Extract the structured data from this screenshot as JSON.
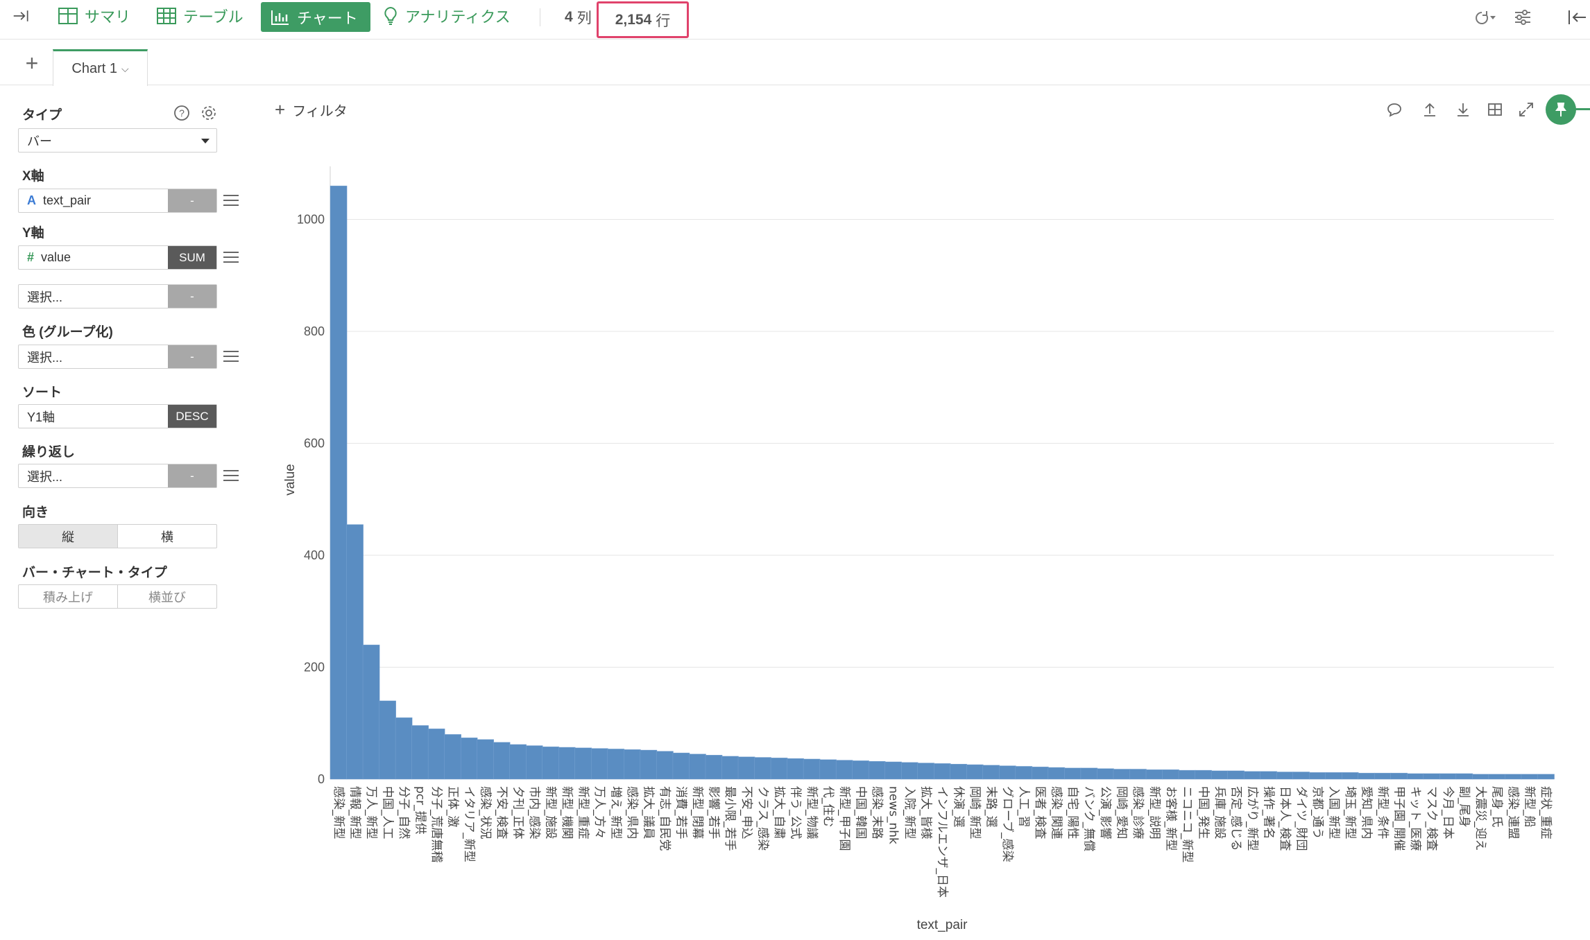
{
  "toolbar": {
    "summary_label": "サマリ",
    "table_label": "テーブル",
    "chart_label": "チャート",
    "analytics_label": "アナリティクス",
    "columns_count": "4",
    "columns_unit": "列",
    "rows_count": "2,154",
    "rows_unit": "行"
  },
  "tabs": {
    "add_label": "+",
    "active_tab": "Chart 1"
  },
  "panel": {
    "type_label": "タイプ",
    "type_value": "バー",
    "x_label": "X軸",
    "x_field": "text_pair",
    "x_field_type_icon": "A",
    "x_agg": "-",
    "y_label": "Y軸",
    "y_field": "value",
    "y_field_type_icon": "#",
    "y_agg": "SUM",
    "y2_placeholder": "選択...",
    "y2_agg": "-",
    "color_label": "色 (グループ化)",
    "color_placeholder": "選択...",
    "color_agg": "-",
    "sort_label": "ソート",
    "sort_field": "Y1軸",
    "sort_order": "DESC",
    "repeat_label": "繰り返し",
    "repeat_placeholder": "選択...",
    "repeat_agg": "-",
    "orientation_label": "向き",
    "orientation_vertical": "縦",
    "orientation_horizontal": "横",
    "bar_type_label": "バー・チャート・タイプ",
    "bar_type_stacked": "積み上げ",
    "bar_type_side": "横並び"
  },
  "chart_area": {
    "filter_label": "フィルタ"
  },
  "colors": {
    "accent": "#3e9c64",
    "bar": "#5a8dc2",
    "highlight": "#e0426b"
  },
  "chart_data": {
    "type": "bar",
    "xlabel": "text_pair",
    "ylabel": "value",
    "ylim": [
      0,
      1070
    ],
    "yticks": [
      0,
      200,
      400,
      600,
      800,
      1000
    ],
    "grid": true,
    "categories": [
      "感染_新型",
      "情報_新型",
      "万人_新型",
      "中国_人工",
      "分子_自然",
      "pcr_提供",
      "分子_荒唐無稽",
      "正体_激",
      "イタリア_新型",
      "感染_状況",
      "不安_検査",
      "夕刊_正体",
      "市内_感染",
      "新型_施設",
      "新型_機関",
      "新型_重症",
      "万人_方々",
      "増え_新型",
      "感染_県内",
      "拡大_議員",
      "有志_自民党",
      "消費_若手",
      "新型_閉幕",
      "影響_若手",
      "最小限_若手",
      "不安_申込",
      "クラス_感染",
      "拡大_自粛",
      "伴う_公式",
      "新型_物議",
      "代_住む",
      "新型_甲子園",
      "中国_韓国",
      "感染_末路",
      "news_nhk",
      "入院_新型",
      "拡大_皆様",
      "インフルエンザ_日本",
      "休演_選",
      "岡崎_新型",
      "末路_選",
      "グローブ_感染",
      "人工_習",
      "医者_検査",
      "感染_関連",
      "自宅_陽性",
      "バンク_無償",
      "公演_影響",
      "岡崎_愛知",
      "感染_診療",
      "新型_説明",
      "お客様_新型",
      "ニコニコ_新型",
      "中国_発生",
      "兵庫_施設",
      "否定_感じる",
      "広がり_新型",
      "操作_著名",
      "日本人_検査",
      "ダイツ_財団",
      "京都_通う",
      "入国_新型",
      "埼玉_新型",
      "愛知_県内",
      "新型_条件",
      "甲子園_開催",
      "キット_医療",
      "マスク_検査",
      "今月_日本",
      "副_尾身",
      "大震災_迎え",
      "尾身_氏",
      "感染_連盟",
      "新型_船",
      "症状_重症"
    ],
    "values": [
      1060,
      455,
      240,
      140,
      110,
      96,
      90,
      80,
      74,
      71,
      66,
      62,
      60,
      58,
      57,
      56,
      55,
      54,
      53,
      52,
      50,
      47,
      45,
      43,
      41,
      40,
      39,
      38,
      37,
      36,
      35,
      34,
      33,
      32,
      31,
      30,
      29,
      28,
      27,
      26,
      25,
      24,
      23,
      22,
      21,
      20,
      20,
      19,
      18,
      18,
      17,
      17,
      16,
      16,
      15,
      15,
      14,
      14,
      13,
      13,
      12,
      12,
      12,
      11,
      11,
      11,
      10,
      10,
      10,
      10,
      9,
      9,
      9,
      9,
      9
    ]
  }
}
